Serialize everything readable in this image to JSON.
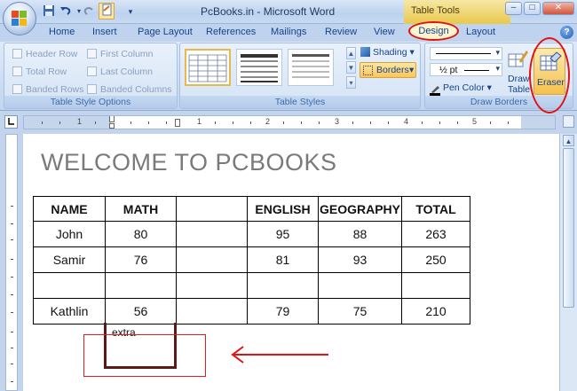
{
  "window": {
    "title": "PcBooks.in - Microsoft Word",
    "context_title": "Table Tools",
    "min_label": "–",
    "max_label": "□",
    "close_label": "✕"
  },
  "quick_access": {
    "save_icon": "save-icon",
    "undo_icon": "undo-icon",
    "redo_icon": "redo-icon",
    "new_icon": "new-document-icon",
    "customize_icon": "customize-icon"
  },
  "tabs": [
    "Home",
    "Insert",
    "Page Layout",
    "References",
    "Mailings",
    "Review",
    "View",
    "Design",
    "Layout"
  ],
  "help_label": "?",
  "ribbon": {
    "style_options": {
      "label": "Table Style Options",
      "items": [
        "Header Row",
        "First Column",
        "Total Row",
        "Last Column",
        "Banded Rows",
        "Banded Columns"
      ]
    },
    "table_styles": {
      "label": "Table Styles"
    },
    "shading_label": "Shading",
    "borders_label": "Borders",
    "draw_borders": {
      "label": "Draw Borders",
      "weight": "½ pt",
      "pen_color": "Pen Color",
      "draw_table_1": "Draw",
      "draw_table_2": "Table",
      "eraser": "Eraser"
    }
  },
  "ruler": {
    "numbers": [
      "1",
      "1",
      "2",
      "3",
      "4",
      "5"
    ]
  },
  "document": {
    "heading": "WELCOME TO PCBOOKS",
    "table": {
      "headers": [
        "NAME",
        "MATH",
        "",
        "ENGLISH",
        "GEOGRAPHY",
        "TOTAL"
      ],
      "rows": [
        [
          "John",
          "80",
          "",
          "95",
          "88",
          "263"
        ],
        [
          "Samir",
          "76",
          "",
          "81",
          "93",
          "250"
        ],
        [
          "",
          "",
          "",
          "",
          "",
          ""
        ],
        [
          "Kathlin",
          "56",
          "",
          "79",
          "75",
          "210"
        ]
      ]
    },
    "extra_text": "extra"
  },
  "colors": {
    "annotation_red": "#e01212",
    "ribbon_blue": "#15428b",
    "highlight_orange": "#f6c14d"
  }
}
